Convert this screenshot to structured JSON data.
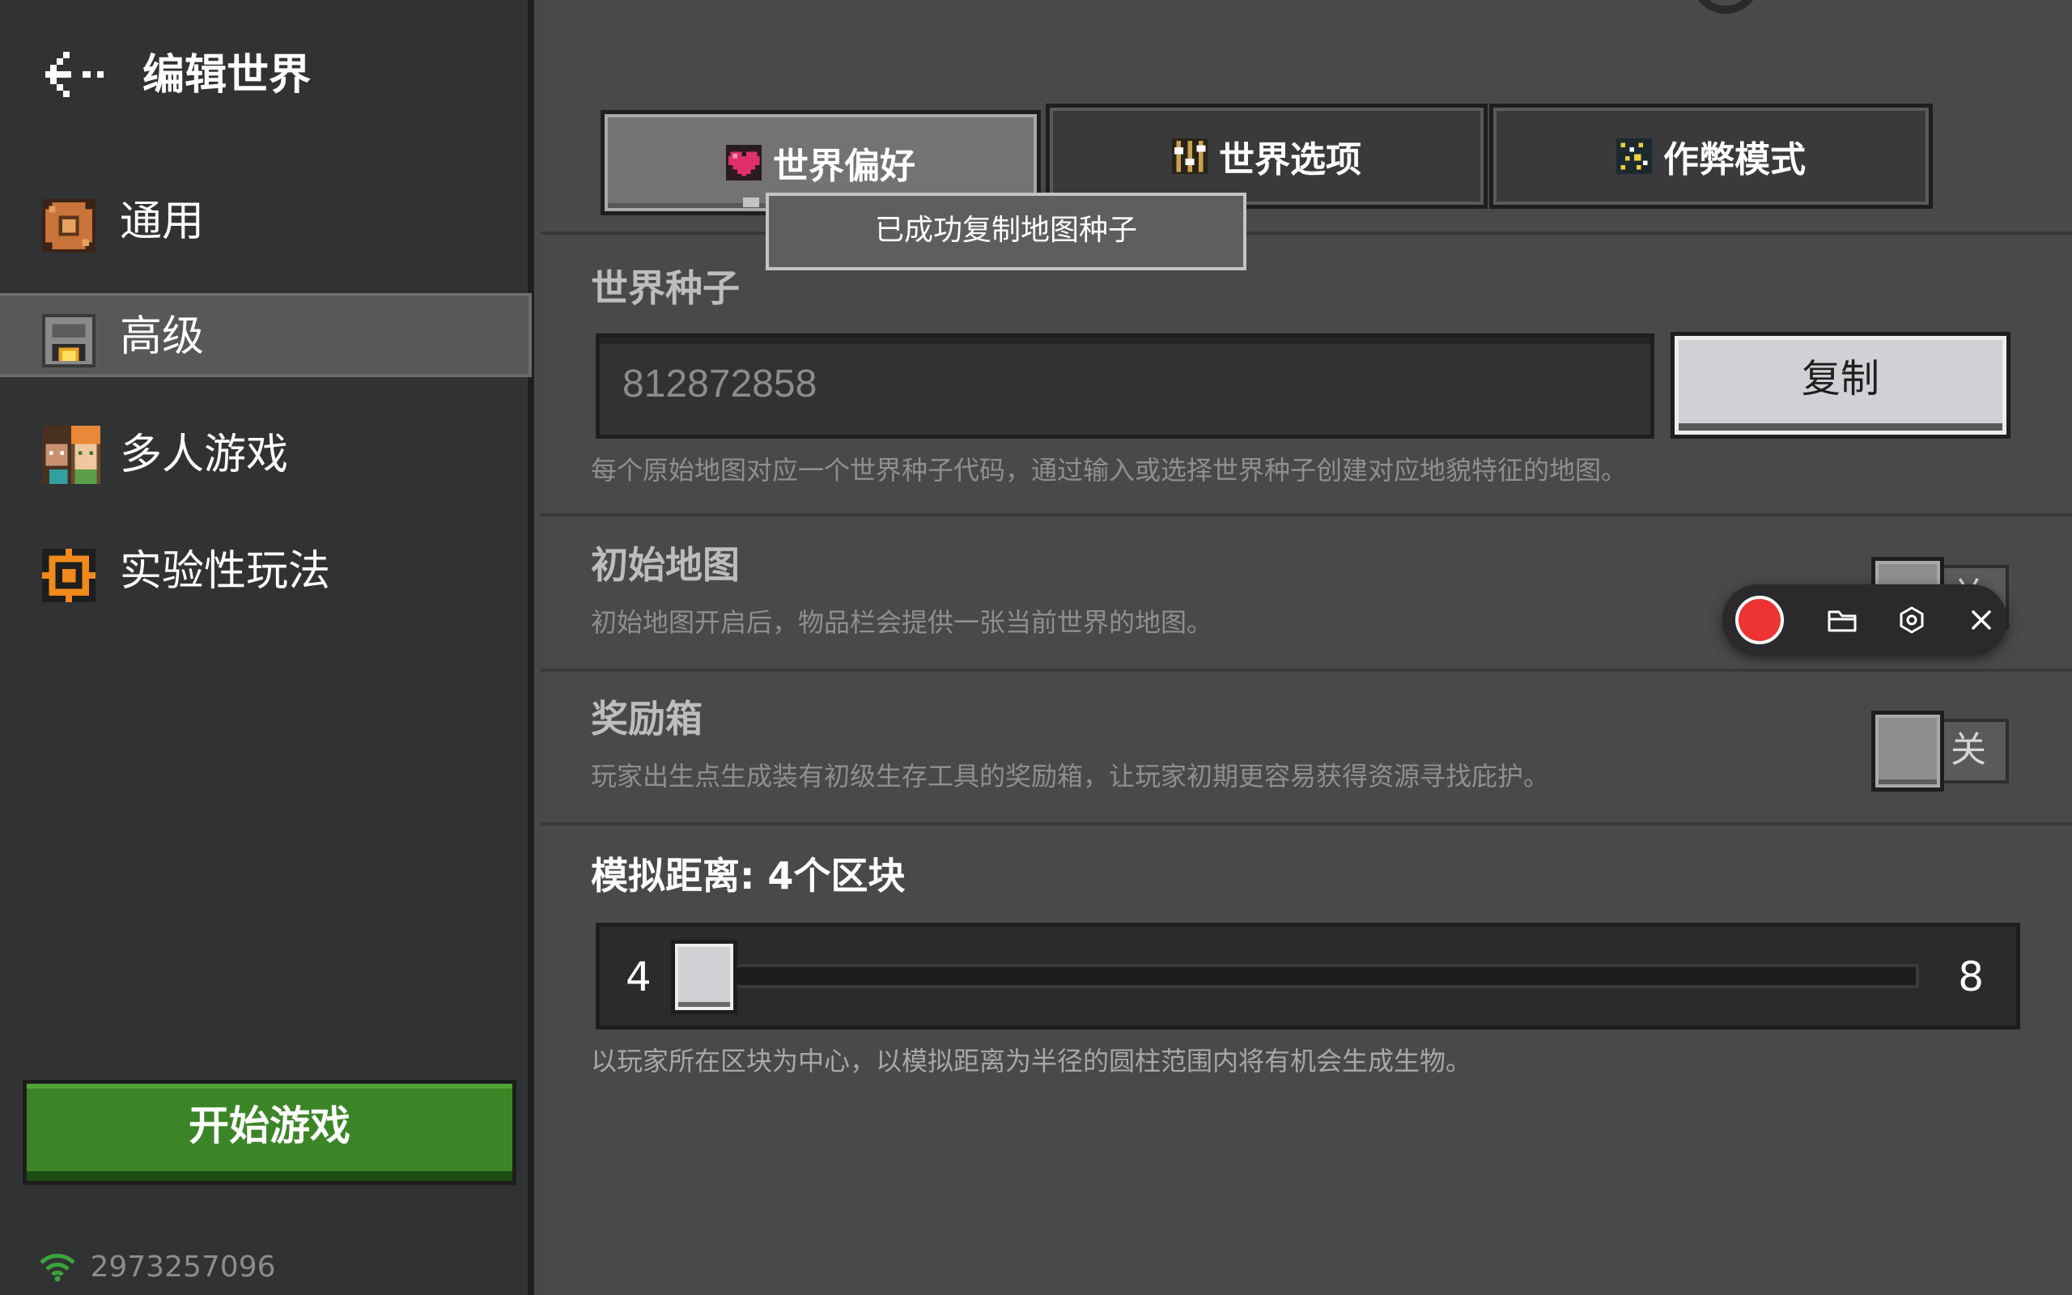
{
  "sidebar": {
    "title": "编辑世界",
    "items": [
      {
        "label": "通用",
        "icon": "gear-icon",
        "active": false
      },
      {
        "label": "高级",
        "icon": "furnace-icon",
        "active": true
      },
      {
        "label": "多人游戏",
        "icon": "multiplayer-avatar-icon",
        "active": false
      },
      {
        "label": "实验性玩法",
        "icon": "experiment-icon",
        "active": false
      }
    ],
    "start_button": "开始游戏",
    "player_id": "2973257096"
  },
  "tabs": [
    {
      "label": "世界偏好",
      "icon": "heart-icon",
      "selected": true
    },
    {
      "label": "世界选项",
      "icon": "sliders-icon",
      "selected": false
    },
    {
      "label": "作弊模式",
      "icon": "cheat-icon",
      "selected": false
    }
  ],
  "toast": "已成功复制地图种子",
  "seed": {
    "title": "世界种子",
    "value": "812872858",
    "copy_label": "复制",
    "description": "每个原始地图对应一个世界种子代码，通过输入或选择世界种子创建对应地貌特征的地图。"
  },
  "starting_map": {
    "title": "初始地图",
    "description": "初始地图开启后，物品栏会提供一张当前世界的地图。",
    "toggle_label": "关"
  },
  "bonus_chest": {
    "title": "奖励箱",
    "description": "玩家出生点生成装有初级生存工具的奖励箱，让玩家初期更容易获得资源寻找庇护。",
    "toggle_label": "关"
  },
  "simulation": {
    "title": "模拟距离: 4个区块",
    "min": "4",
    "max": "8",
    "description": "以玩家所在区块为中心，以模拟距离为半径的圆柱范围内将有机会生成生物。"
  },
  "colors": {
    "start_green": "#3c8527",
    "record_red": "#ee3334",
    "sidebar_bg": "#313233",
    "main_bg": "#48494a"
  }
}
